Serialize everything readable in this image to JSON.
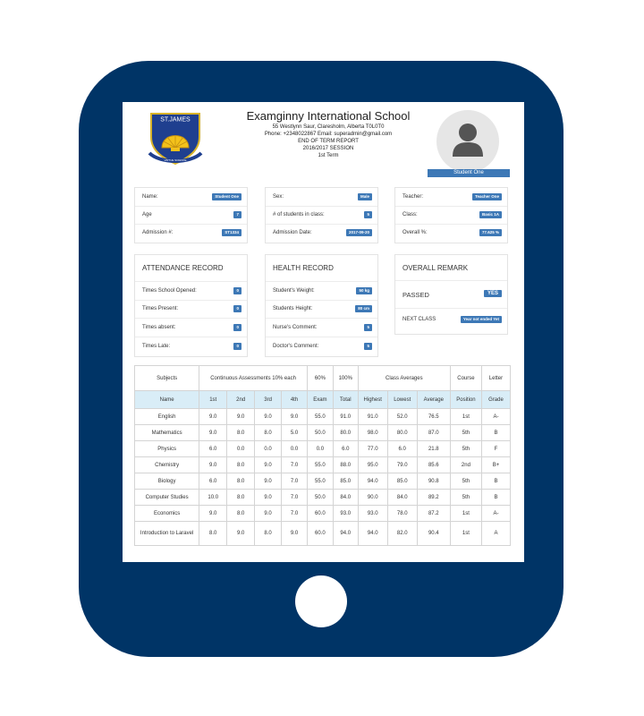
{
  "school": {
    "name": "Examginny International School",
    "address": "55 Westlynn Saur, Claresholm, Alberta T0L0T0",
    "contact": "Phone: +2348022867   Email: superadmin@gmail.com",
    "report_title": "END OF TERM REPORT",
    "session": "2016/2017   SESSION",
    "term": "1st Term",
    "logo_text": "ST.JAMES",
    "logo_motto": "VIRTUE SCIENCE"
  },
  "student_label": "Student One",
  "student_info": [
    {
      "label": "Name:",
      "value": "Student One"
    },
    {
      "label": "Age",
      "value": "7"
    },
    {
      "label": "Admission #:",
      "value": "ST1334"
    }
  ],
  "class_info": [
    {
      "label": "Sex:",
      "value": "Male"
    },
    {
      "label": "# of students in class:",
      "value": "5"
    },
    {
      "label": "Admission Date:",
      "value": "2017-09-20"
    }
  ],
  "teacher_info": [
    {
      "label": "Teacher:",
      "value": "Teacher One"
    },
    {
      "label": "Class:",
      "value": "Basic 1A"
    },
    {
      "label": "Overall %:",
      "value": "77.625 %"
    }
  ],
  "attendance": {
    "title": "ATTENDANCE RECORD",
    "rows": [
      {
        "label": "Times School Opened:",
        "value": "0"
      },
      {
        "label": "Times Present:",
        "value": "0"
      },
      {
        "label": "Times absent:",
        "value": "0"
      },
      {
        "label": "Times Late:",
        "value": "0"
      }
    ]
  },
  "health": {
    "title": "HEALTH RECORD",
    "rows": [
      {
        "label": "Student's Weight:",
        "value": "50 kg"
      },
      {
        "label": "Students Height:",
        "value": "80 cm"
      },
      {
        "label": "Nurse's Comment:",
        "value": "5"
      },
      {
        "label": "Doctor's Comment:",
        "value": "5"
      }
    ]
  },
  "remark": {
    "title": "OVERALL REMARK",
    "passed_label": "PASSED",
    "passed_value": "YES",
    "next_label": "NEXT CLASS",
    "next_value": "Year not ended Yet"
  },
  "table": {
    "header1": {
      "subjects": "Subjects",
      "ca": "Continuous Assessments 10% each",
      "exam_pct": "60%",
      "total_pct": "100%",
      "class_avg": "Class Averages",
      "course": "Course",
      "letter": "Letter"
    },
    "header2": [
      "Name",
      "1st",
      "2nd",
      "3rd",
      "4th",
      "Exam",
      "Total",
      "Highest",
      "Lowest",
      "Average",
      "Position",
      "Grade"
    ],
    "rows": [
      [
        "English",
        "9.0",
        "9.0",
        "9.0",
        "9.0",
        "55.0",
        "91.0",
        "91.0",
        "52.0",
        "76.5",
        "1st",
        "A-"
      ],
      [
        "Mathematics",
        "9.0",
        "8.0",
        "8.0",
        "5.0",
        "50.0",
        "80.0",
        "98.0",
        "80.0",
        "87.0",
        "5th",
        "B"
      ],
      [
        "Physics",
        "6.0",
        "0.0",
        "0.0",
        "0.0",
        "0.0",
        "6.0",
        "77.0",
        "6.0",
        "21.8",
        "5th",
        "F"
      ],
      [
        "Chemistry",
        "9.0",
        "8.0",
        "9.0",
        "7.0",
        "55.0",
        "88.0",
        "95.0",
        "79.0",
        "85.6",
        "2nd",
        "B+"
      ],
      [
        "Biology",
        "6.0",
        "8.0",
        "9.0",
        "7.0",
        "55.0",
        "85.0",
        "94.0",
        "85.0",
        "90.8",
        "5th",
        "B"
      ],
      [
        "Computer Studies",
        "10.0",
        "8.0",
        "9.0",
        "7.0",
        "50.0",
        "84.0",
        "90.0",
        "84.0",
        "89.2",
        "5th",
        "B"
      ],
      [
        "Economics",
        "9.0",
        "8.0",
        "9.0",
        "7.0",
        "60.0",
        "93.0",
        "93.0",
        "78.0",
        "87.2",
        "1st",
        "A-"
      ],
      [
        "Introduction to Laravel",
        "8.0",
        "9.0",
        "8.0",
        "9.0",
        "60.0",
        "94.0",
        "94.0",
        "82.0",
        "90.4",
        "1st",
        "A"
      ]
    ]
  },
  "colors": {
    "tablet": "#003466",
    "badge": "#3d78b6",
    "table_header": "#d9edf7"
  }
}
